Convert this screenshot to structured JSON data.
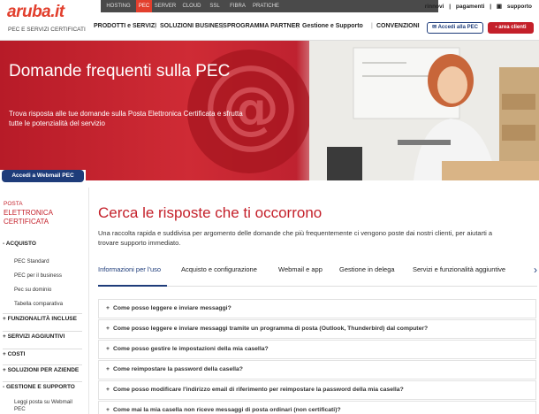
{
  "header": {
    "logo_text": "aruba.it",
    "logo_sub": "PEC E SERVIZI CERTIFICATI",
    "top_tabs": [
      "HOSTING",
      "PEC",
      "SERVER",
      "CLOUD",
      "SSL",
      "FIBRA",
      "PRATICHE"
    ],
    "utility": [
      "rinnovi",
      "pagamenti",
      "supporto"
    ],
    "nav": [
      "PRODOTTI e SERVIZI",
      "SOLUZIONI BUSINESS",
      "PROGRAMMA PARTNER",
      "Gestione e Supporto",
      "CONVENZIONI"
    ],
    "webmail_button": "Accedi alla PEC",
    "area_button": "area clienti"
  },
  "hero": {
    "title": "Domande frequenti sulla PEC",
    "description": "Trova risposta alle tue domande sulla Posta Elettronica Certificata e sfrutta tutte le potenzialità del servizio"
  },
  "sidebar": {
    "webmail_button": "Accedi a Webmail PEC",
    "heading_line1": "POSTA",
    "heading_line2": "ELETTRONICA CERTIFICATA",
    "items": [
      {
        "label": "- ACQUISTO",
        "type": "group"
      },
      {
        "label": "PEC Standard",
        "type": "sub"
      },
      {
        "label": "PEC per il business",
        "type": "sub"
      },
      {
        "label": "Pec su dominio",
        "type": "sub"
      },
      {
        "label": "Tabella comparativa",
        "type": "sub"
      },
      {
        "label": "+ FUNZIONALITÀ INCLUSE",
        "type": "group"
      },
      {
        "label": "+ SERVIZI AGGIUNTIVI",
        "type": "group"
      },
      {
        "label": "+ COSTI",
        "type": "group"
      },
      {
        "label": "+ SOLUZIONI PER AZIENDE",
        "type": "group"
      },
      {
        "label": "- GESTIONE E SUPPORTO",
        "type": "group"
      },
      {
        "label": "Leggi posta su Webmail PEC",
        "type": "sub"
      }
    ]
  },
  "main": {
    "title": "Cerca le risposte che ti occorrono",
    "intro": "Una raccolta rapida e suddivisa per argomento delle domande che più frequentemente ci vengono poste dai nostri clienti, per aiutarti a trovare supporto immediato.",
    "tabs": [
      "Informazioni per l'uso",
      "Acquisto e configurazione",
      "Webmail e app",
      "Gestione in delega",
      "Servizi e funzionalità aggiuntive"
    ],
    "tab_arrow": "›",
    "faq_prefix": "+",
    "faqs": [
      "Come posso leggere e inviare messaggi?",
      "Come posso leggere e inviare messaggi tramite un programma di posta (Outlook, Thunderbird) dal computer?",
      "Come posso gestire le impostazioni della mia casella?",
      "Come reimpostare la password della casella?",
      "Come posso modificare l'indirizzo email di riferimento per reimpostare la password della mia casella?",
      "Come mai la mia casella non riceve messaggi di posta ordinari (non certificati)?"
    ]
  },
  "colors": {
    "brand_red": "#c4202a",
    "navy": "#1e3c7a",
    "topbar": "#4a4a4a"
  }
}
